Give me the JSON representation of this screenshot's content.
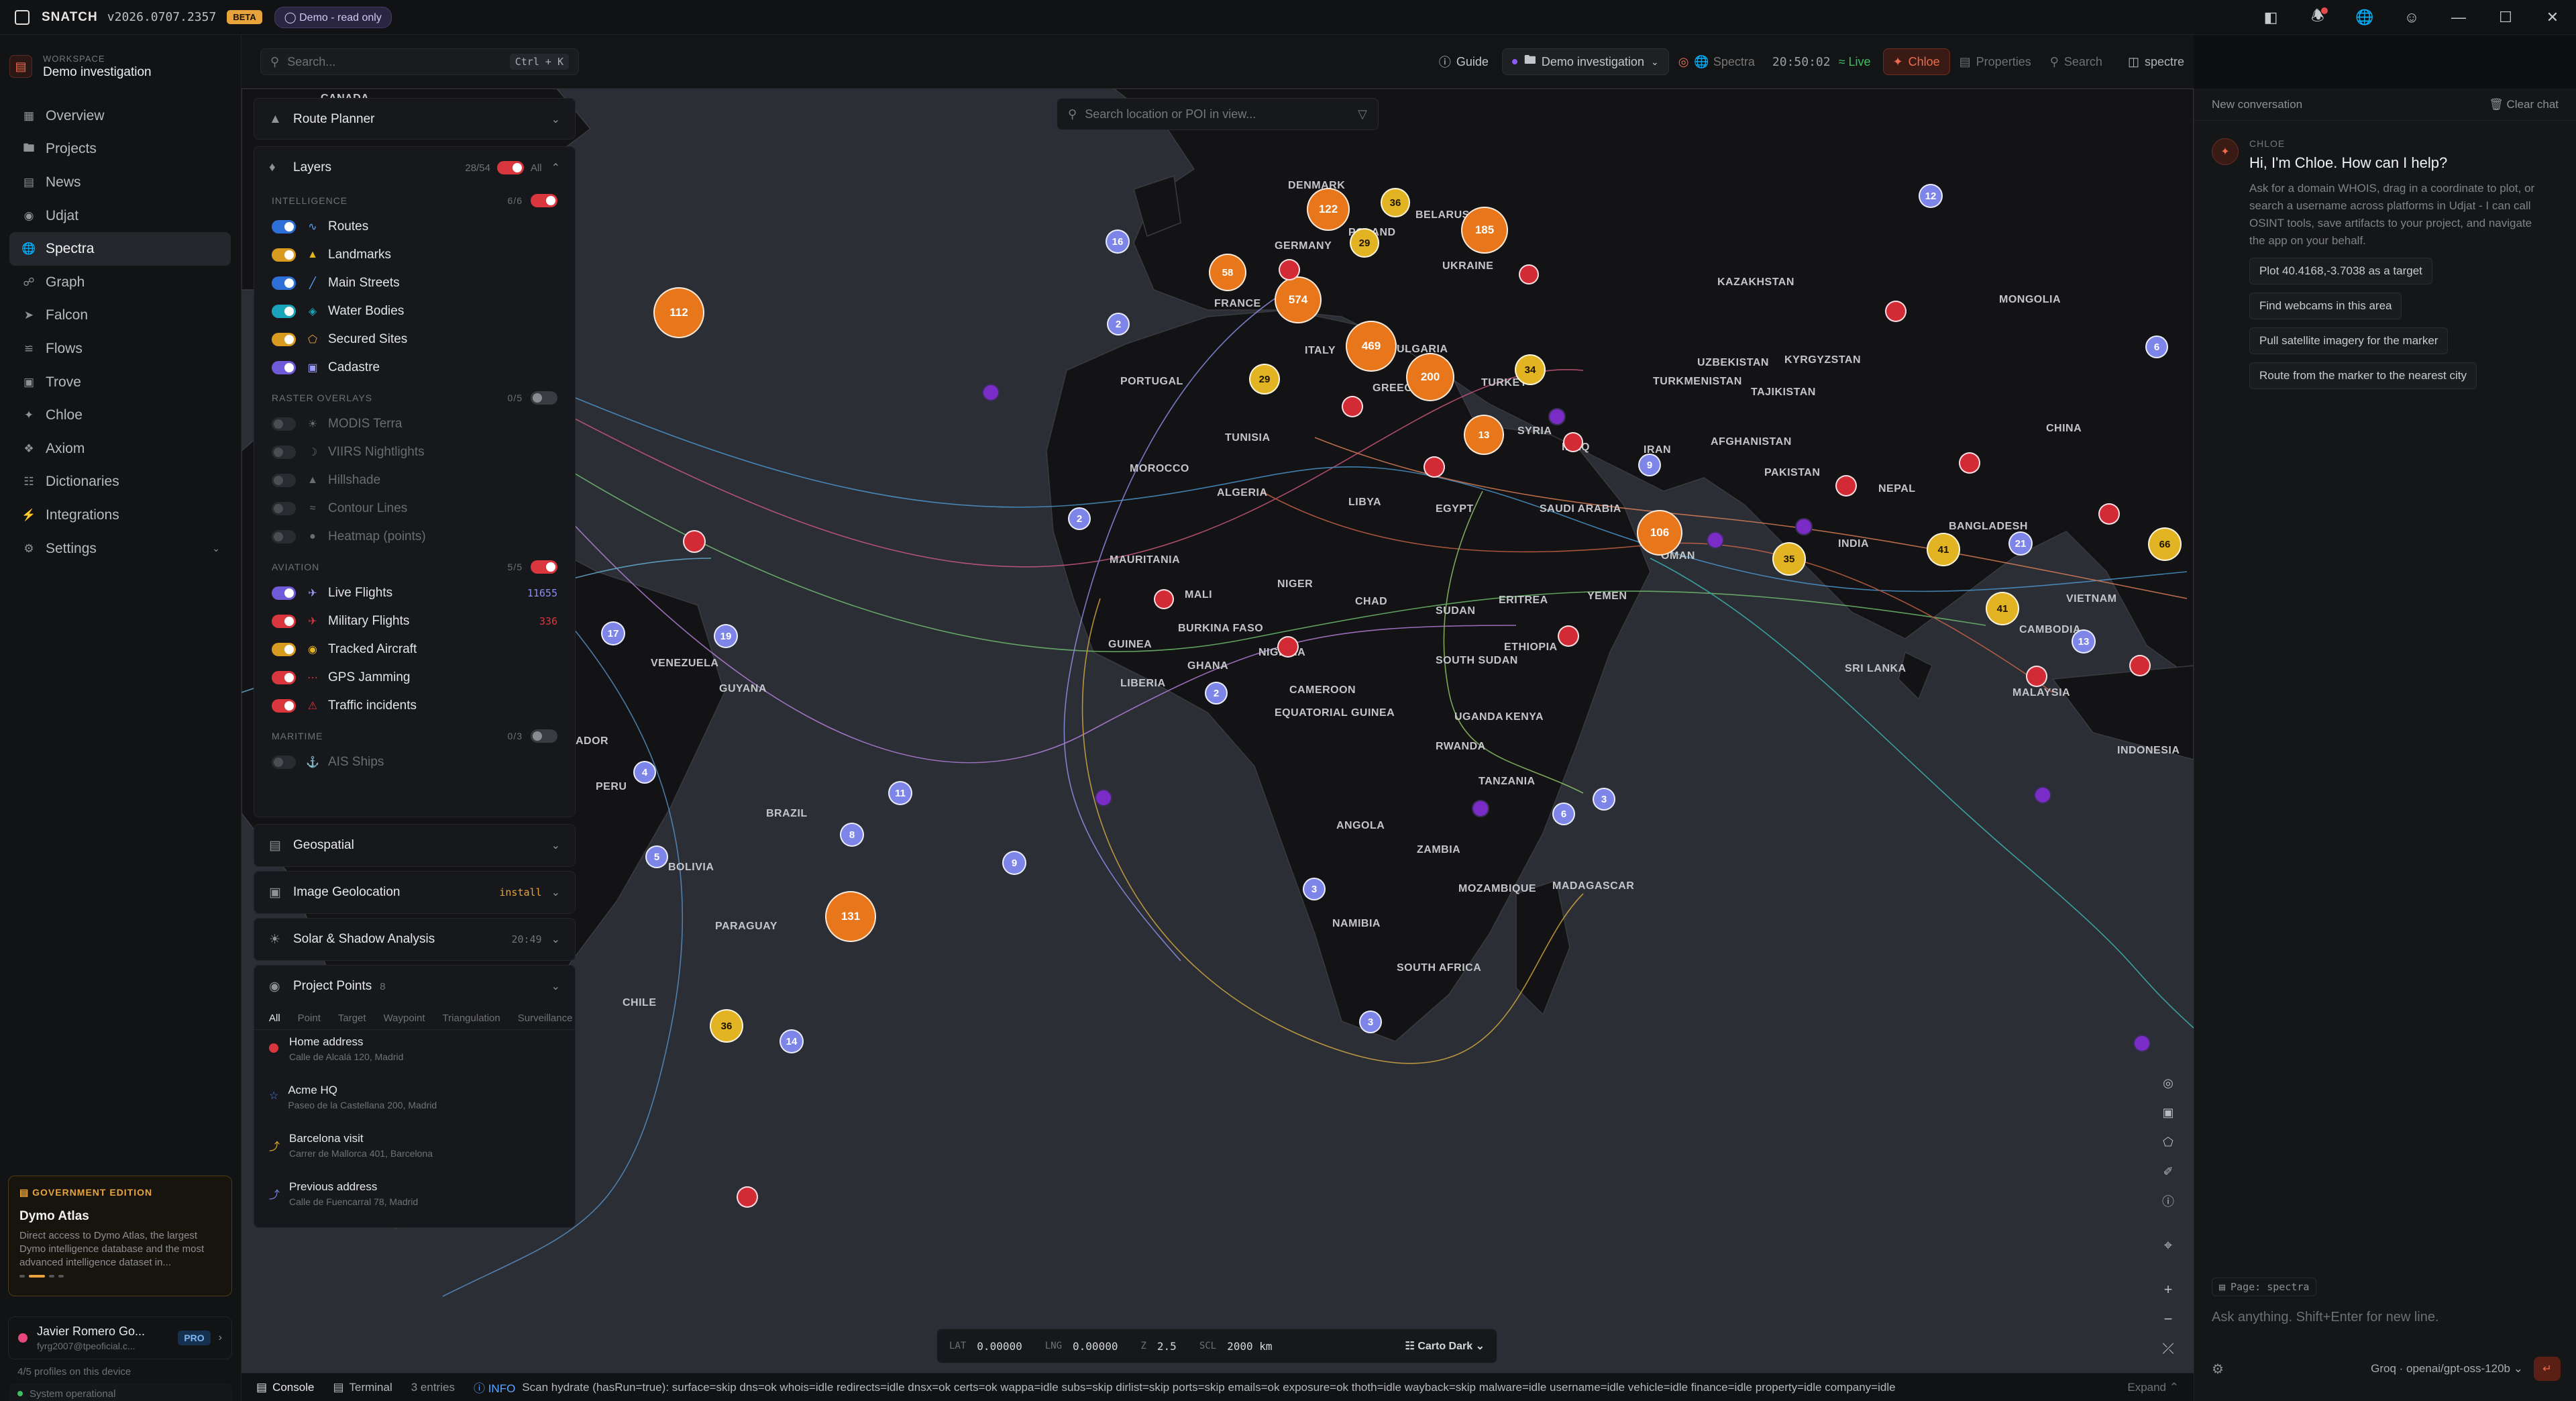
{
  "app": {
    "name": "SNATCH",
    "version": "v2026.0707.2357",
    "beta": "BETA",
    "mode_pill": "Demo - read only"
  },
  "workspace": {
    "caption": "WORKSPACE",
    "name": "Demo investigation"
  },
  "nav": [
    {
      "label": "Overview",
      "icon": "grid-icon"
    },
    {
      "label": "Projects",
      "icon": "folder-icon"
    },
    {
      "label": "News",
      "icon": "news-icon"
    },
    {
      "label": "Udjat",
      "icon": "eye-icon"
    },
    {
      "label": "Spectra",
      "icon": "globe-icon",
      "active": true
    },
    {
      "label": "Graph",
      "icon": "graph-icon"
    },
    {
      "label": "Falcon",
      "icon": "falcon-icon"
    },
    {
      "label": "Flows",
      "icon": "flows-icon"
    },
    {
      "label": "Trove",
      "icon": "trove-icon"
    },
    {
      "label": "Chloe",
      "icon": "chloe-icon"
    },
    {
      "label": "Axiom",
      "icon": "axiom-icon"
    },
    {
      "label": "Dictionaries",
      "icon": "book-icon"
    },
    {
      "label": "Integrations",
      "icon": "plug-icon"
    },
    {
      "label": "Settings",
      "icon": "gear-icon"
    }
  ],
  "gov": {
    "caption": "GOVERNMENT EDITION",
    "title": "Dymo Atlas",
    "body": "Direct access to Dymo Atlas, the largest Dymo intelligence database and the most advanced intelligence dataset in..."
  },
  "user": {
    "name": "Javier Romero Go...",
    "email": "fyrg2007@tpeoficial.c...",
    "badge": "PRO",
    "profiles": "4/5 profiles on this device",
    "status": "System operational"
  },
  "topbar": {
    "search_placeholder": "Search...",
    "search_kbd": "Ctrl + K",
    "guide": "Guide",
    "investigation": "Demo investigation",
    "spectra": "Spectra",
    "clock": "20:50:02",
    "live": "Live",
    "chloe": "Chloe",
    "properties": "Properties",
    "search": "Search",
    "spectre": "spectre"
  },
  "panel": {
    "route_planner": "Route Planner",
    "layers": {
      "title": "Layers",
      "count": "28/54",
      "all": "All"
    },
    "intelligence": {
      "label": "INTELLIGENCE",
      "count": "6/6",
      "rows": [
        "Routes",
        "Landmarks",
        "Main Streets",
        "Water Bodies",
        "Secured Sites",
        "Cadastre"
      ]
    },
    "raster": {
      "label": "RASTER OVERLAYS",
      "count": "0/5",
      "rows": [
        "MODIS Terra",
        "VIIRS Nightlights",
        "Hillshade",
        "Contour Lines",
        "Heatmap (points)"
      ]
    },
    "aviation": {
      "label": "AVIATION",
      "count": "5/5",
      "rows": [
        {
          "label": "Live Flights",
          "value": "11655"
        },
        {
          "label": "Military Flights",
          "value": "336"
        },
        {
          "label": "Tracked Aircraft",
          "value": ""
        },
        {
          "label": "GPS Jamming",
          "value": ""
        },
        {
          "label": "Traffic incidents",
          "value": ""
        }
      ]
    },
    "maritime": {
      "label": "MARITIME",
      "count": "0/3",
      "rows": [
        "AIS Ships"
      ]
    },
    "geospatial": "Geospatial",
    "image_geo": {
      "title": "Image Geolocation",
      "tag": "install"
    },
    "solar": {
      "title": "Solar & Shadow Analysis",
      "time": "20:49"
    },
    "project_points": {
      "title": "Project Points",
      "count": "8",
      "tabs": [
        "All",
        "Point",
        "Target",
        "Waypoint",
        "Triangulation",
        "Surveillance"
      ],
      "items": [
        {
          "title": "Home address",
          "sub": "Calle de Alcalá 120, Madrid",
          "color": "#d9363e"
        },
        {
          "title": "Acme HQ",
          "sub": "Paseo de la Castellana 200, Madrid",
          "color": "#3b82f6"
        },
        {
          "title": "Barcelona visit",
          "sub": "Carrer de Mallorca 401, Barcelona",
          "color": "#e2b322"
        },
        {
          "title": "Previous address",
          "sub": "Calle de Fuencarral 78, Madrid",
          "color": "#7d85e8"
        }
      ]
    }
  },
  "map": {
    "search_placeholder": "Search location or POI in view...",
    "coords": {
      "lat_k": "LAT",
      "lat": "0.00000",
      "lng_k": "LNG",
      "lng": "0.00000",
      "z_k": "Z",
      "z": "2.5",
      "scl_k": "SCL",
      "scl": "2000 km",
      "basemap": "Carto Dark"
    },
    "labels": [
      "DENMARK",
      "GERMANY",
      "POLAND",
      "BELARUS",
      "UKRAINE",
      "FRANCE",
      "ITALY",
      "PORTUGAL",
      "GREECE",
      "BULGARIA",
      "TURKEY",
      "SYRIA",
      "IRAQ",
      "IRAN",
      "KAZAKHSTAN",
      "UZBEKISTAN",
      "KYRGYZSTAN",
      "TURKMENISTAN",
      "TAJIKISTAN",
      "AFGHANISTAN",
      "PAKISTAN",
      "MONGOLIA",
      "CHINA",
      "NEPAL",
      "BANGLADESH",
      "INDIA",
      "VIETNAM",
      "CAMBODIA",
      "SRI LANKA",
      "MALAYSIA",
      "INDONESIA",
      "SAUDI ARABIA",
      "OMAN",
      "YEMEN",
      "EGYPT",
      "LIBYA",
      "ALGERIA",
      "TUNISIA",
      "MOROCCO",
      "MAURITANIA",
      "MALI",
      "NIGER",
      "CHAD",
      "SUDAN",
      "SOUTH SUDAN",
      "ERITREA",
      "ETHIOPIA",
      "BURKINA FASO",
      "GUINEA",
      "GHANA",
      "LIBERIA",
      "NIGERIA",
      "CAMEROON",
      "EQUATORIAL GUINEA",
      "UGANDA",
      "KENYA",
      "RWANDA",
      "TANZANIA",
      "ANGOLA",
      "ZAMBIA",
      "MOZAMBIQUE",
      "MADAGASCAR",
      "NAMIBIA",
      "SOUTH AFRICA",
      "VENEZUELA",
      "GUYANA",
      "PERU",
      "BRAZIL",
      "BOLIVIA",
      "PARAGUAY",
      "CHILE",
      "ADOR",
      "CANADA"
    ],
    "markers": [
      "122",
      "185",
      "36",
      "29",
      "574",
      "58",
      "112",
      "469",
      "200",
      "29",
      "34",
      "13",
      "106",
      "35",
      "41",
      "41",
      "66",
      "131",
      "36",
      "17",
      "19",
      "16",
      "2",
      "2",
      "6",
      "8",
      "9",
      "12",
      "13",
      "14",
      "11",
      "21",
      "3",
      "3",
      "3",
      "4",
      "5",
      "6",
      "9",
      "2",
      "3"
    ]
  },
  "chat": {
    "new_conversation": "New conversation",
    "clear": "Clear chat",
    "author": "CHLOE",
    "greeting": "Hi, I'm Chloe. How can I help?",
    "intro": "Ask for a domain WHOIS, drag in a coordinate to plot, or search a username across platforms in Udjat - I can call OSINT tools, save artifacts to your project, and navigate the app on your behalf.",
    "suggestions": [
      "Plot 40.4168,-3.7038 as a target",
      "Find webcams in this area",
      "Pull satellite imagery for the marker",
      "Route from the marker to the nearest city"
    ],
    "page": "Page: spectra",
    "placeholder": "Ask anything. Shift+Enter for new line.",
    "model": "Groq · openai/gpt-oss-120b"
  },
  "status": {
    "console": "Console",
    "terminal": "Terminal",
    "entries": "3 entries",
    "level": "INFO",
    "message": "Scan hydrate (hasRun=true): surface=skip dns=ok whois=idle redirects=idle dnsx=ok certs=ok wappa=idle subs=skip dirlist=skip ports=skip emails=ok exposure=ok thoth=idle wayback=skip malware=idle username=idle vehicle=idle finance=idle property=idle company=idle",
    "expand": "Expand"
  },
  "colors": {
    "accent": "#ef6b4a",
    "live": "#3fbf5f",
    "beta": "#e8a33c"
  }
}
